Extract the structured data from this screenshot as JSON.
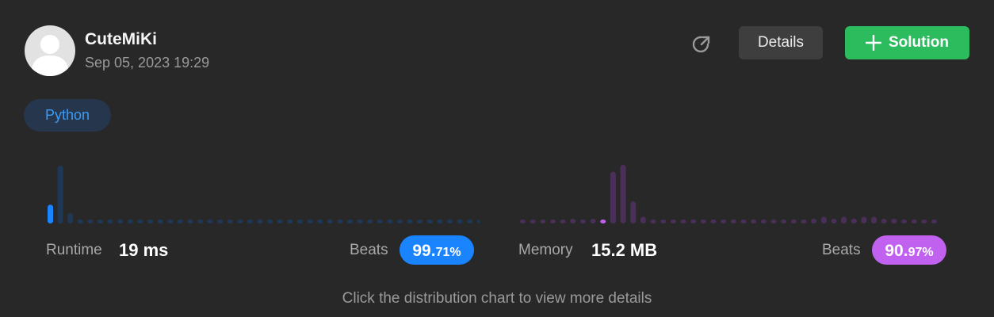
{
  "user": {
    "name": "CuteMiKi",
    "timestamp": "Sep 05, 2023 19:29"
  },
  "actions": {
    "share_icon": "share-arrow-icon",
    "details_label": "Details",
    "solution_label": "Solution",
    "solution_icon": "plus-icon"
  },
  "language": "Python",
  "runtime": {
    "label": "Runtime",
    "value": "19 ms",
    "beats_label": "Beats",
    "beats_int": "99.",
    "beats_dec": "71%",
    "accent": "#1a84ff",
    "dim": "#1e3957"
  },
  "memory": {
    "label": "Memory",
    "value": "15.2 MB",
    "beats_label": "Beats",
    "beats_int": "90.",
    "beats_dec": "97%",
    "accent": "#c061f0",
    "dim": "#4a2f58"
  },
  "chart_data": [
    {
      "type": "bar",
      "series": [
        {
          "values": [
            0.28,
            0.86,
            0.15,
            0.05,
            0.05,
            0.05,
            0.05,
            0.05,
            0.05,
            0.05,
            0.05,
            0.05,
            0.05,
            0.05,
            0.05,
            0.05,
            0.05,
            0.05,
            0.05,
            0.05,
            0.05,
            0.05,
            0.05,
            0.05,
            0.06,
            0.05,
            0.05,
            0.05,
            0.05,
            0.05,
            0.05,
            0.05,
            0.05,
            0.05,
            0.05,
            0.05,
            0.05,
            0.05,
            0.05,
            0.05,
            0.05,
            0.05,
            0.05,
            0.05
          ]
        }
      ],
      "highlight_index": 0
    },
    {
      "type": "bar",
      "series": [
        {
          "values": [
            0.05,
            0.05,
            0.05,
            0.05,
            0.05,
            0.07,
            0.05,
            0.07,
            0.05,
            0.77,
            0.87,
            0.33,
            0.1,
            0.05,
            0.05,
            0.05,
            0.05,
            0.05,
            0.05,
            0.05,
            0.05,
            0.05,
            0.05,
            0.05,
            0.05,
            0.05,
            0.05,
            0.05,
            0.05,
            0.07,
            0.1,
            0.07,
            0.1,
            0.07,
            0.1,
            0.1,
            0.07,
            0.07,
            0.05,
            0.05,
            0.05,
            0.05
          ]
        }
      ],
      "highlight_index": 8
    }
  ],
  "footer_hint": "Click the distribution chart to view more details"
}
